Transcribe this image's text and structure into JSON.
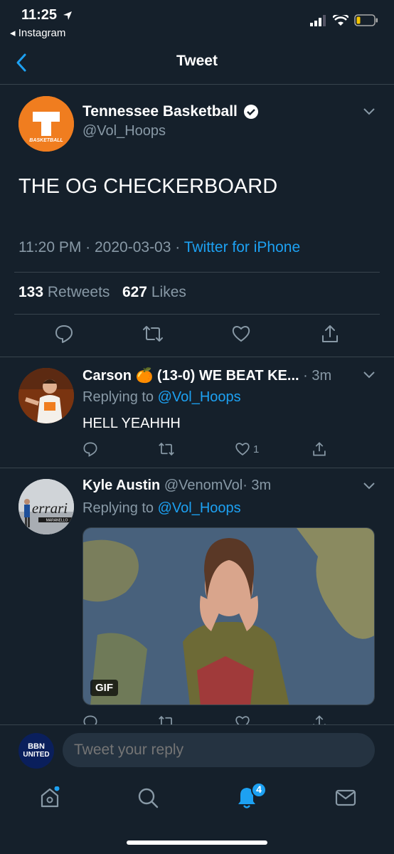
{
  "status": {
    "time": "11:25",
    "back_app": "◂ Instagram"
  },
  "nav": {
    "title": "Tweet"
  },
  "main_tweet": {
    "name": "Tennessee Basketball",
    "handle": "@Vol_Hoops",
    "avatar_letter": "T",
    "avatar_sub": "BASKETBALL",
    "text": "THE OG CHECKERBOARD",
    "time": "11:20 PM",
    "date": "2020-03-03",
    "source": "Twitter for iPhone",
    "retweets_count": "133",
    "retweets_label": "Retweets",
    "likes_count": "627",
    "likes_label": "Likes"
  },
  "replies": [
    {
      "name": "Carson 🍊 (13-0) WE BEAT KE...",
      "time": "· 3m",
      "replying_label": "Replying to ",
      "replying_to": "@Vol_Hoops",
      "text": "HELL YEAHHH",
      "likes": "1"
    },
    {
      "name": "Kyle Austin",
      "handle": "@VenomVol",
      "time": "· 3m",
      "replying_label": "Replying to ",
      "replying_to": "@Vol_Hoops",
      "gif_label": "GIF",
      "avatar_text": "errari",
      "avatar_subtext": "MARANELLO"
    }
  ],
  "reply_bar": {
    "avatar_line1": "BBN",
    "avatar_line2": "UNITED",
    "placeholder": "Tweet your reply"
  },
  "tabbar": {
    "notifications_badge": "4"
  },
  "colors": {
    "background": "#15202b",
    "accent": "#1da1f2",
    "muted": "#8899a6",
    "divider": "#38444d",
    "orange": "#f07d1f"
  },
  "icons": [
    "location-arrow-icon",
    "signal-icon",
    "wifi-icon",
    "battery-icon",
    "back-chevron-icon",
    "verified-icon",
    "chevron-down-icon",
    "reply-icon",
    "retweet-icon",
    "like-icon",
    "share-icon",
    "home-icon",
    "search-icon",
    "bell-icon",
    "mail-icon"
  ]
}
